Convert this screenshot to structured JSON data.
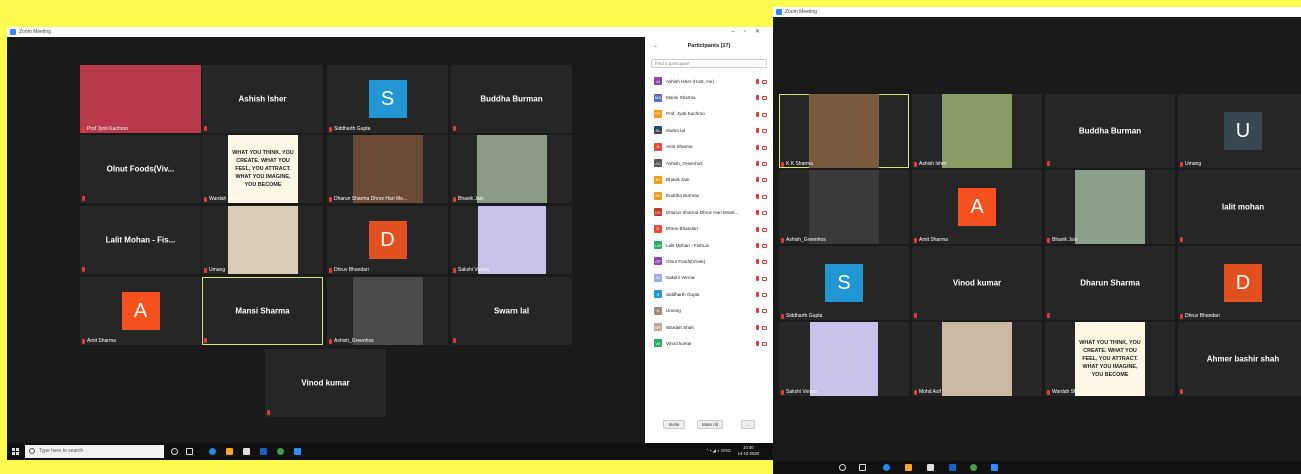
{
  "window_title": "Zoom Meeting",
  "left_gallery": [
    {
      "id": "t1",
      "name": "Prof Jyoti Kachroo",
      "type": "photo",
      "label": "Prof Jyoti Kachroo"
    },
    {
      "id": "t2",
      "name": "Ashish Isher",
      "type": "name",
      "label": ""
    },
    {
      "id": "t3",
      "name": "Siddharth Gupta",
      "type": "avatar",
      "letter": "S",
      "color": "#2196d3",
      "label": "Siddharth Gupta"
    },
    {
      "id": "t4",
      "name": "Buddha Burman",
      "type": "name",
      "label": ""
    },
    {
      "id": "t5",
      "name": "Olnut Foods(Viv...",
      "type": "name",
      "label": ""
    },
    {
      "id": "t6",
      "name": "Wardah Shah",
      "type": "quote",
      "label": "Wardah Shah"
    },
    {
      "id": "t7",
      "name": "Dharun Sharma Dhruv Hari Moti...",
      "type": "photo",
      "label": "Dharun Sharma Dhruv Hari Mo..."
    },
    {
      "id": "t8",
      "name": "Bhavik Jain",
      "type": "photo",
      "label": "Bhavik Jain"
    },
    {
      "id": "t9",
      "name": "Lalit Mohan - Fis...",
      "type": "name",
      "label": ""
    },
    {
      "id": "t10",
      "name": "Umang",
      "type": "photo",
      "label": "Umang"
    },
    {
      "id": "t11",
      "name": "Dhruv Bhandari",
      "type": "avatar",
      "letter": "D",
      "color": "#e1501e",
      "label": "Dhruv Bhandari"
    },
    {
      "id": "t12",
      "name": "Sakshi Verma",
      "type": "sketch",
      "label": "Sakshi Verma"
    },
    {
      "id": "t13",
      "name": "Amit Sharma",
      "type": "avatar",
      "letter": "A",
      "color": "#f4511e",
      "label": "Amit Sharma"
    },
    {
      "id": "t14",
      "name": "Mansi Sharma",
      "type": "name",
      "label": ""
    },
    {
      "id": "t15",
      "name": "Ashish_Greenhos",
      "type": "photo",
      "label": "Ashish_Greenhos"
    },
    {
      "id": "t16",
      "name": "Swarn lal",
      "type": "name",
      "label": ""
    },
    {
      "id": "t17",
      "name": "Vinod kumar",
      "type": "name",
      "label": ""
    }
  ],
  "quote_text": "WHAT YOU THINK, YOU CREATE. WHAT YOU FEEL, YOU ATTRACT. WHAT YOU IMAGINE, YOU BECOME",
  "participants": {
    "title": "Participants (17)",
    "search_placeholder": "Find a participant",
    "items": [
      {
        "initials": "AI",
        "name": "Ashish Isher (Host, me)",
        "color": "#8e44ad"
      },
      {
        "initials": "MS",
        "name": "Mansi Sharma",
        "color": "#5c6bc0"
      },
      {
        "initials": "PK",
        "name": "Prof. Jyoti Kachroo",
        "color": "#f39c12"
      },
      {
        "initials": "SL",
        "name": "Swarn lal",
        "color": "#34495e"
      },
      {
        "initials": "A",
        "name": "Amit Sharma",
        "color": "#e74c3c"
      },
      {
        "initials": "AG",
        "name": "Ashish_Greenhos",
        "color": "#555555"
      },
      {
        "initials": "BJ",
        "name": "Bhavik Jain",
        "color": "#f39c12"
      },
      {
        "initials": "BB",
        "name": "Buddha Burman",
        "color": "#f39c12"
      },
      {
        "initials": "DS",
        "name": "Dharun Sharma Dhruv Hari Motel...",
        "color": "#c0392b"
      },
      {
        "initials": "D",
        "name": "Dhruv Bhandari",
        "color": "#e74c3c"
      },
      {
        "initials": "LM",
        "name": "Lalit Mohan - FishLai",
        "color": "#27ae60"
      },
      {
        "initials": "OF",
        "name": "Olnut Foods(Vivek)",
        "color": "#8e44ad"
      },
      {
        "initials": "SV",
        "name": "Sakshi Verma",
        "color": "#9fa8da"
      },
      {
        "initials": "S",
        "name": "Siddharth Gupta",
        "color": "#2196d3"
      },
      {
        "initials": "U",
        "name": "Umang",
        "color": "#a1887f"
      },
      {
        "initials": "WS",
        "name": "Wardah Shah",
        "color": "#bcaaa4"
      },
      {
        "initials": "VK",
        "name": "Vinod kumar",
        "color": "#27ae60"
      }
    ],
    "invite_label": "Invite",
    "mute_all_label": "Mute All",
    "more_label": "..."
  },
  "taskbar": {
    "search_placeholder": "Type here to search",
    "lang": "ENG",
    "time": "10:40",
    "date": "14-10-2020"
  },
  "right_gallery": [
    {
      "name": "K K Sharma",
      "type": "photo",
      "label": "K K Sharma"
    },
    {
      "name": "Ashish Isher",
      "type": "photo",
      "label": "Ashish Isher"
    },
    {
      "name": "Buddha Burman",
      "type": "name",
      "label": ""
    },
    {
      "name": "Umang",
      "type": "avatar",
      "letter": "U",
      "color": "#37474f",
      "label": "Umang"
    },
    {
      "name": "Ashish_Greenhos",
      "type": "photo",
      "label": "Ashish_Greenhos"
    },
    {
      "name": "Amit Sharma",
      "type": "avatar",
      "letter": "A",
      "color": "#f4511e",
      "label": "Amit Sharma"
    },
    {
      "name": "Bhavik Jain",
      "type": "photo",
      "label": "Bhavik Jain"
    },
    {
      "name": "lalit mohan",
      "type": "name",
      "label": ""
    },
    {
      "name": "Siddharth Gupta",
      "type": "avatar",
      "letter": "S",
      "color": "#2196d3",
      "label": "Siddharth Gupta"
    },
    {
      "name": "Vinod kumar",
      "type": "name",
      "label": ""
    },
    {
      "name": "Dharun Sharma",
      "type": "name",
      "label": ""
    },
    {
      "name": "Dhruv Bhandari",
      "type": "avatar",
      "letter": "D",
      "color": "#e1501e",
      "label": "Dhruv Bhandari"
    },
    {
      "name": "Sakshi Verma",
      "type": "sketch",
      "label": "Sakshi Verma"
    },
    {
      "name": "Mohd Asif",
      "type": "photo",
      "label": "Mohd Asif"
    },
    {
      "name": "Wardah Shah",
      "type": "quote",
      "label": "Wardah Shah"
    },
    {
      "name": "Ahmer bashir shah",
      "type": "name",
      "label": ""
    }
  ]
}
